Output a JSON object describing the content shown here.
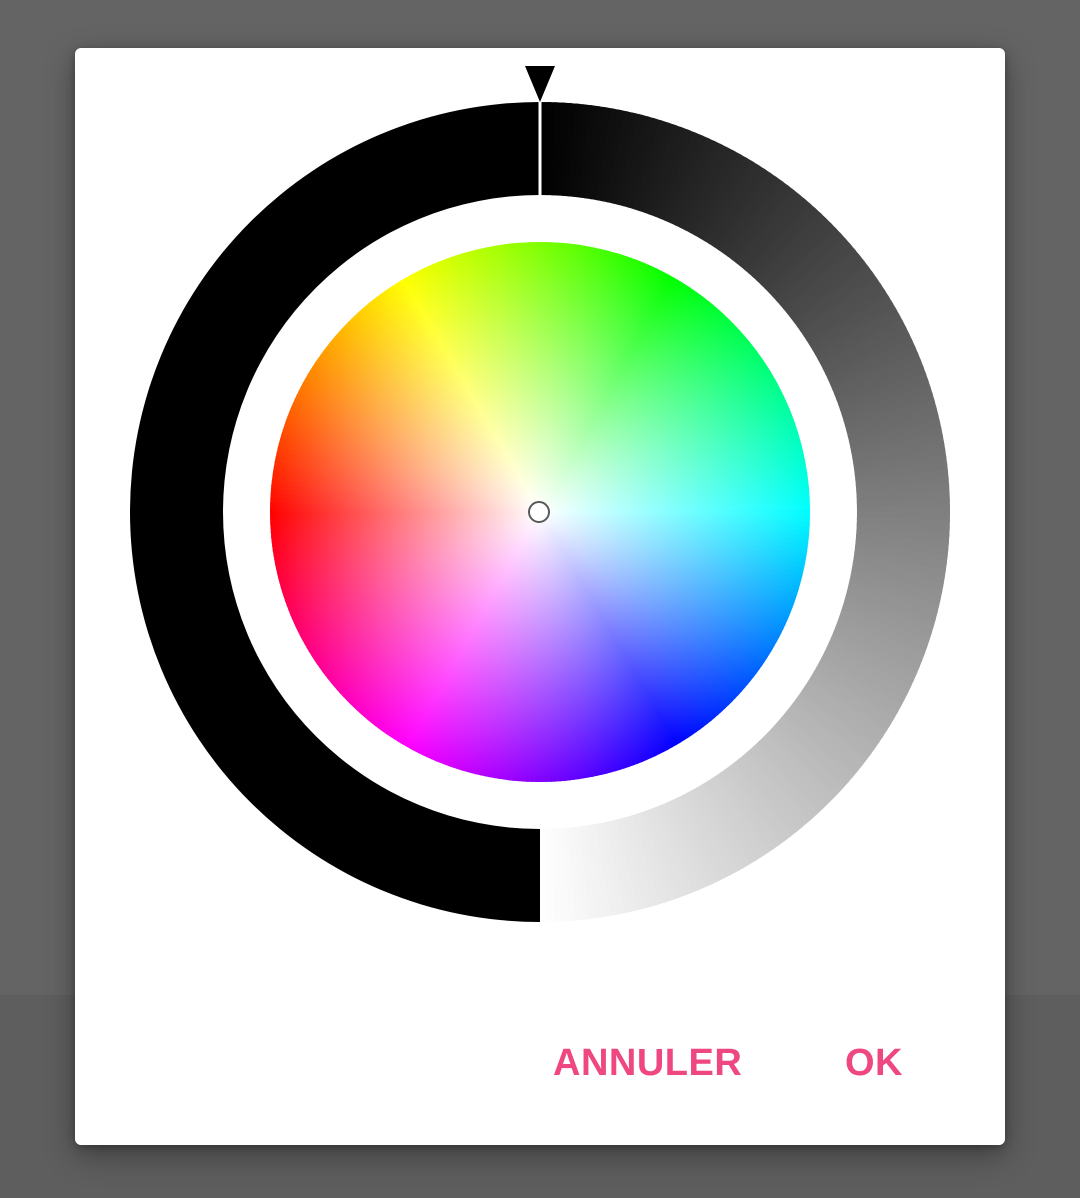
{
  "dialog": {
    "accent_color": "#EE4781",
    "cancel_label": "ANNULER",
    "ok_label": "OK"
  },
  "color_picker": {
    "selected_hue_deg": 0,
    "selected_saturation": 0,
    "brightness_fraction": 0.0,
    "brightness_ring_colors": [
      "#000000",
      "#ffffff"
    ],
    "hue_wheel_icon": "color-wheel",
    "brightness_marker_icon": "triangle-down"
  }
}
